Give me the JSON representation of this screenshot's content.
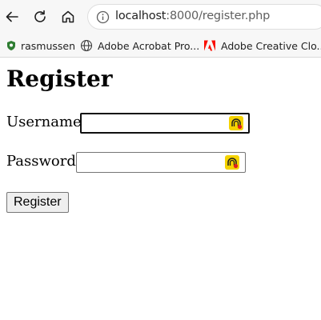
{
  "browser": {
    "url_host": "localhost",
    "url_rest": ":8000/register.php",
    "bookmarks": [
      {
        "label": "rasmussen",
        "icon": "shield-icon"
      },
      {
        "label": "Adobe Acrobat Pro...",
        "icon": "globe-icon"
      },
      {
        "label": "Adobe Creative Clo...",
        "icon": "adobe-icon"
      }
    ]
  },
  "page": {
    "title": "Register",
    "username_label": "Username:",
    "username_value": "",
    "password_label": "Password:",
    "password_value": "",
    "submit_label": "Register"
  },
  "colors": {
    "adobe_red": "#fa0f00",
    "password_icon_yellow": "#f5d300",
    "focus_border": "#101010"
  }
}
